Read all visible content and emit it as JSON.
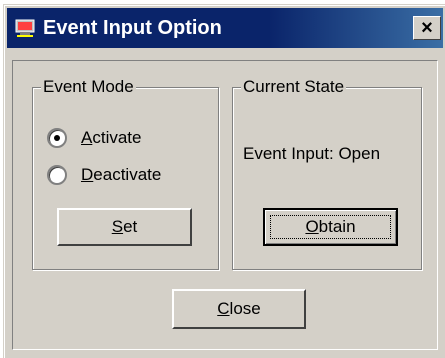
{
  "window": {
    "title": "Event Input Option",
    "close_glyph": "×",
    "icon": "app-window-icon"
  },
  "event_mode": {
    "label": "Event Mode",
    "options": [
      {
        "accel": "A",
        "rest": "ctivate",
        "checked": true
      },
      {
        "accel": "D",
        "rest": "eactivate",
        "checked": false
      }
    ],
    "set_button": {
      "accel": "S",
      "rest": "et"
    }
  },
  "current_state": {
    "label": "Current State",
    "status_text": "Event Input: Open",
    "obtain_button": {
      "accel": "O",
      "rest": "btain"
    }
  },
  "close_button": {
    "accel": "C",
    "rest": "lose"
  },
  "colors": {
    "titlebar": "#0a246a",
    "face": "#d4d0c8"
  }
}
